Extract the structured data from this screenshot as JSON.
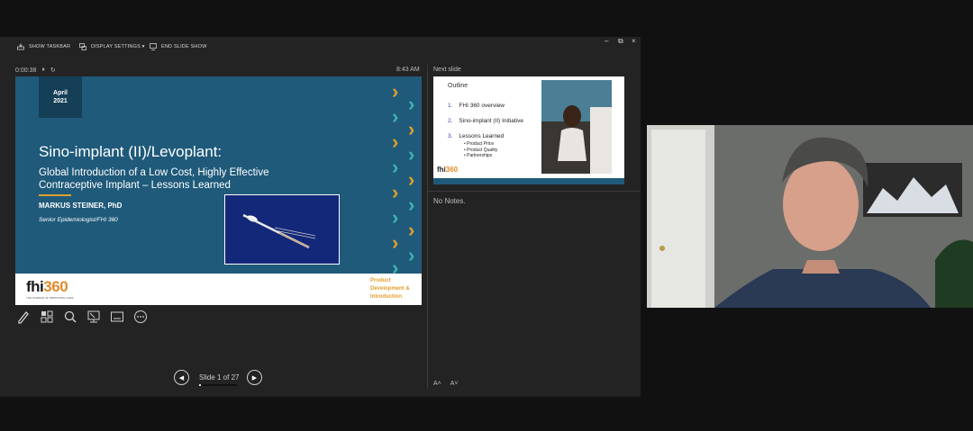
{
  "toolbar": {
    "show_taskbar": "SHOW TASKBAR",
    "display_settings": "DISPLAY SETTINGS ▾",
    "end_slide_show": "END SLIDE SHOW"
  },
  "window_controls": {
    "minimize": "–",
    "restore": "⧉",
    "close": "×"
  },
  "timer": {
    "elapsed": "0:00:38",
    "pause": "⏸",
    "reset": "↻"
  },
  "clock": "8:43 AM",
  "current_slide": {
    "date_line1": "April",
    "date_line2": "2021",
    "title": "Sino-implant (II)/Levoplant:",
    "subtitle": "Global Introduction of a Low Cost, Highly Effective Contraceptive Implant – Lessons Learned",
    "author": "MARKUS STEINER, PhD",
    "role": "Senior Epidemiologist/FHI 360",
    "logo_fhi": "fhi",
    "logo_num": "360",
    "logo_tagline": "THE SCIENCE OF IMPROVING LIVES",
    "footer_text": "Product Development & Introduction",
    "chevron_color_a": "#e29f2b",
    "chevron_color_b": "#3fb5b0"
  },
  "tools": [
    "pen-icon",
    "slides-grid-icon",
    "zoom-icon",
    "pointer-screen-icon",
    "subtitles-icon",
    "more-options-icon"
  ],
  "navigation": {
    "prev": "◀",
    "next": "▶",
    "slide_counter": "Slide 1 of 27",
    "progress_fraction": 0.037
  },
  "next_slide": {
    "label": "Next slide",
    "title": "Outline",
    "items": [
      {
        "num": "1.",
        "text": "FHI 360 overview"
      },
      {
        "num": "2.",
        "text": "Sino-implant (II) Initiative"
      },
      {
        "num": "3.",
        "text": "Lessons Learned"
      }
    ],
    "sub_items": [
      "• Product Price",
      "• Product Quality",
      "• Partnerships"
    ],
    "logo_fhi": "fhi",
    "logo_num": "360"
  },
  "notes": "No Notes.",
  "font_controls": {
    "increase": "A˄",
    "decrease": "A˅"
  }
}
